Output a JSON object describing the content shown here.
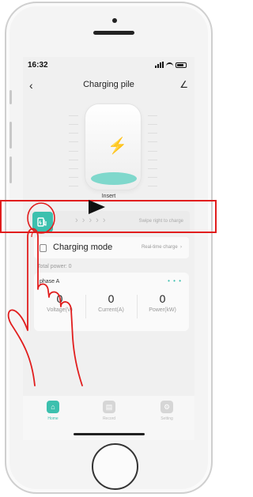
{
  "status_bar": {
    "time": "16:32"
  },
  "nav": {
    "back_icon": "back-chevron-icon",
    "title": "Charging pile",
    "edit_icon": "edit-pen-icon"
  },
  "charger": {
    "connector_label": "Insert",
    "icon": "lightning-bolt-icon"
  },
  "swipe": {
    "arrows": "› › › › ›",
    "hint": "Swipe right to charge",
    "knob_icon": "charger-plug-icon"
  },
  "mode": {
    "label": "Charging mode",
    "value": "Real-time charge",
    "chevron": "›"
  },
  "power": {
    "total_label": "Total power: 0"
  },
  "phase": {
    "label": "phase A",
    "dots": "• • •",
    "metrics": [
      {
        "value": "0",
        "label": "Voltage(V)"
      },
      {
        "value": "0",
        "label": "Current(A)"
      },
      {
        "value": "0",
        "label": "Power(kW)"
      }
    ]
  },
  "tabbar": {
    "tabs": [
      {
        "label": "Home",
        "icon": "home-icon",
        "active": true
      },
      {
        "label": "Record",
        "icon": "record-icon",
        "active": false
      },
      {
        "label": "Setting",
        "icon": "settings-icon",
        "active": false
      }
    ]
  },
  "colors": {
    "accent": "#3cc0ae",
    "highlight": "#e11d1d"
  }
}
